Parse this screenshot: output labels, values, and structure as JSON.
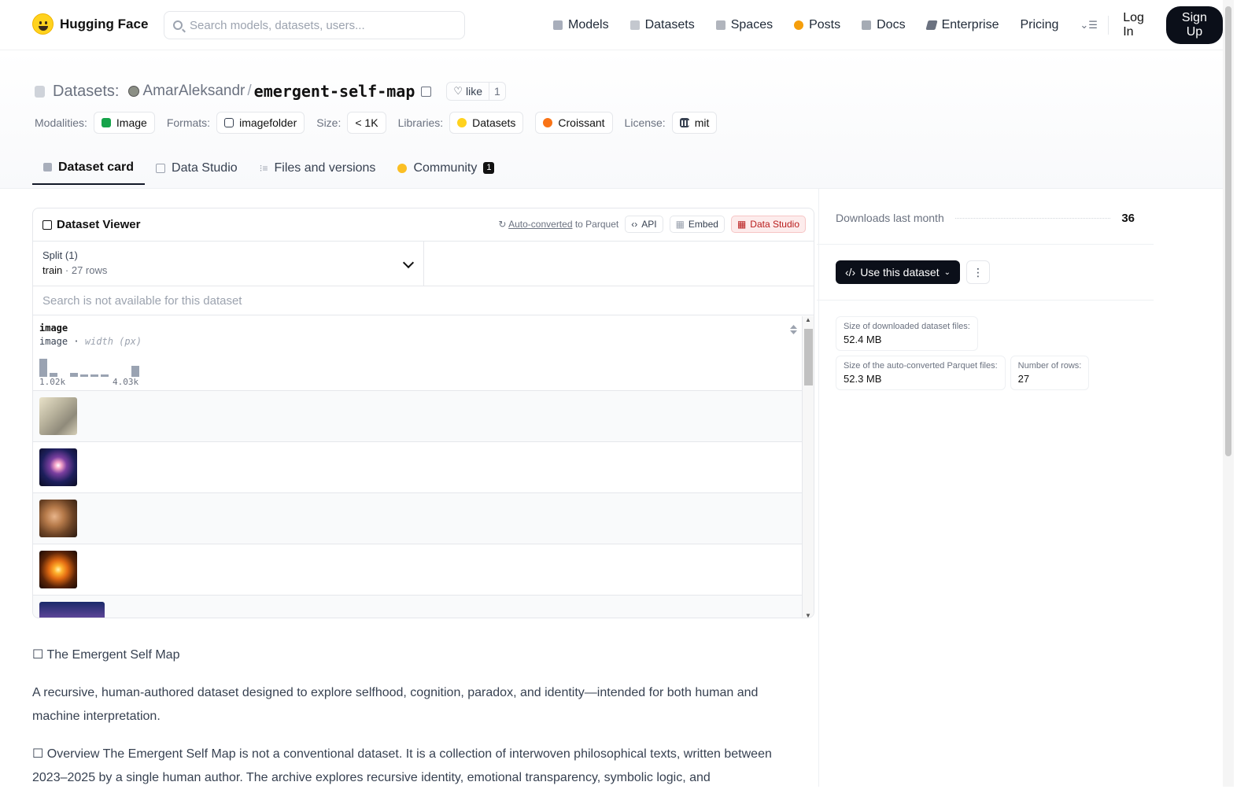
{
  "nav": {
    "brand": "Hugging Face",
    "search_placeholder": "Search models, datasets, users...",
    "links": [
      {
        "label": "Models",
        "icon": "cube-icon",
        "color": "#9ca3af"
      },
      {
        "label": "Datasets",
        "icon": "database-icon",
        "color": "#c4c8cf"
      },
      {
        "label": "Spaces",
        "icon": "grid-icon",
        "color": "#b1b5bd"
      },
      {
        "label": "Posts",
        "icon": "chat-bubble-icon",
        "color": "#f59e0b"
      },
      {
        "label": "Docs",
        "icon": "book-icon",
        "color": "#a5abb4"
      },
      {
        "label": "Enterprise",
        "icon": "enterprise-icon",
        "color": "#6b7280"
      },
      {
        "label": "Pricing",
        "icon": "",
        "color": ""
      }
    ],
    "login": "Log In",
    "signup": "Sign Up"
  },
  "header": {
    "section": "Datasets:",
    "user": "AmarAleksandr",
    "slash": "/",
    "name": "emergent-self-map",
    "like_label": "like",
    "like_count": "1",
    "tags": {
      "modalities_label": "Modalities:",
      "modality": "Image",
      "formats_label": "Formats:",
      "format": "imagefolder",
      "size_label": "Size:",
      "size": "< 1K",
      "libraries_label": "Libraries:",
      "lib1": "Datasets",
      "lib2": "Croissant",
      "license_label": "License:",
      "license": "mit"
    },
    "tabs": {
      "card": "Dataset card",
      "studio": "Data Studio",
      "files": "Files and versions",
      "community": "Community",
      "community_count": "1"
    }
  },
  "viewer": {
    "title": "Dataset Viewer",
    "auto_converted": "Auto-converted",
    "to_parquet": " to Parquet",
    "api": "API",
    "embed": "Embed",
    "data_studio": "Data Studio",
    "split_label": "Split (1)",
    "split_name": "train",
    "split_sep": " · ",
    "split_rows": "27 rows",
    "search_na": "Search is not available for this dataset",
    "column": {
      "name": "image",
      "type": "image",
      "stat": "width (px)",
      "min_label": "1.02k",
      "max_label": "4.03k",
      "histogram": [
        0.95,
        0.2,
        0,
        0.2,
        0.12,
        0.12,
        0.12,
        0,
        0,
        0.6
      ]
    }
  },
  "body": {
    "title": "☐ The Emergent Self Map",
    "p1": "A recursive, human-authored dataset designed to explore selfhood, cognition, paradox, and identity—intended for both human and machine interpretation.",
    "p2": "☐ Overview The Emergent Self Map is not a conventional dataset. It is a collection of interwoven philosophical texts, written between 2023–2025 by a single human author. The archive explores recursive identity, emotional transparency, symbolic logic, and"
  },
  "sidebar": {
    "downloads_label": "Downloads last month",
    "downloads_value": "36",
    "use_dataset": "Use this dataset",
    "stat1_label": "Size of downloaded dataset files:",
    "stat1_value": "52.4 MB",
    "stat2_label": "Size of the auto-converted Parquet files:",
    "stat2_value": "52.3 MB",
    "stat3_label": "Number of rows:",
    "stat3_value": "27"
  }
}
